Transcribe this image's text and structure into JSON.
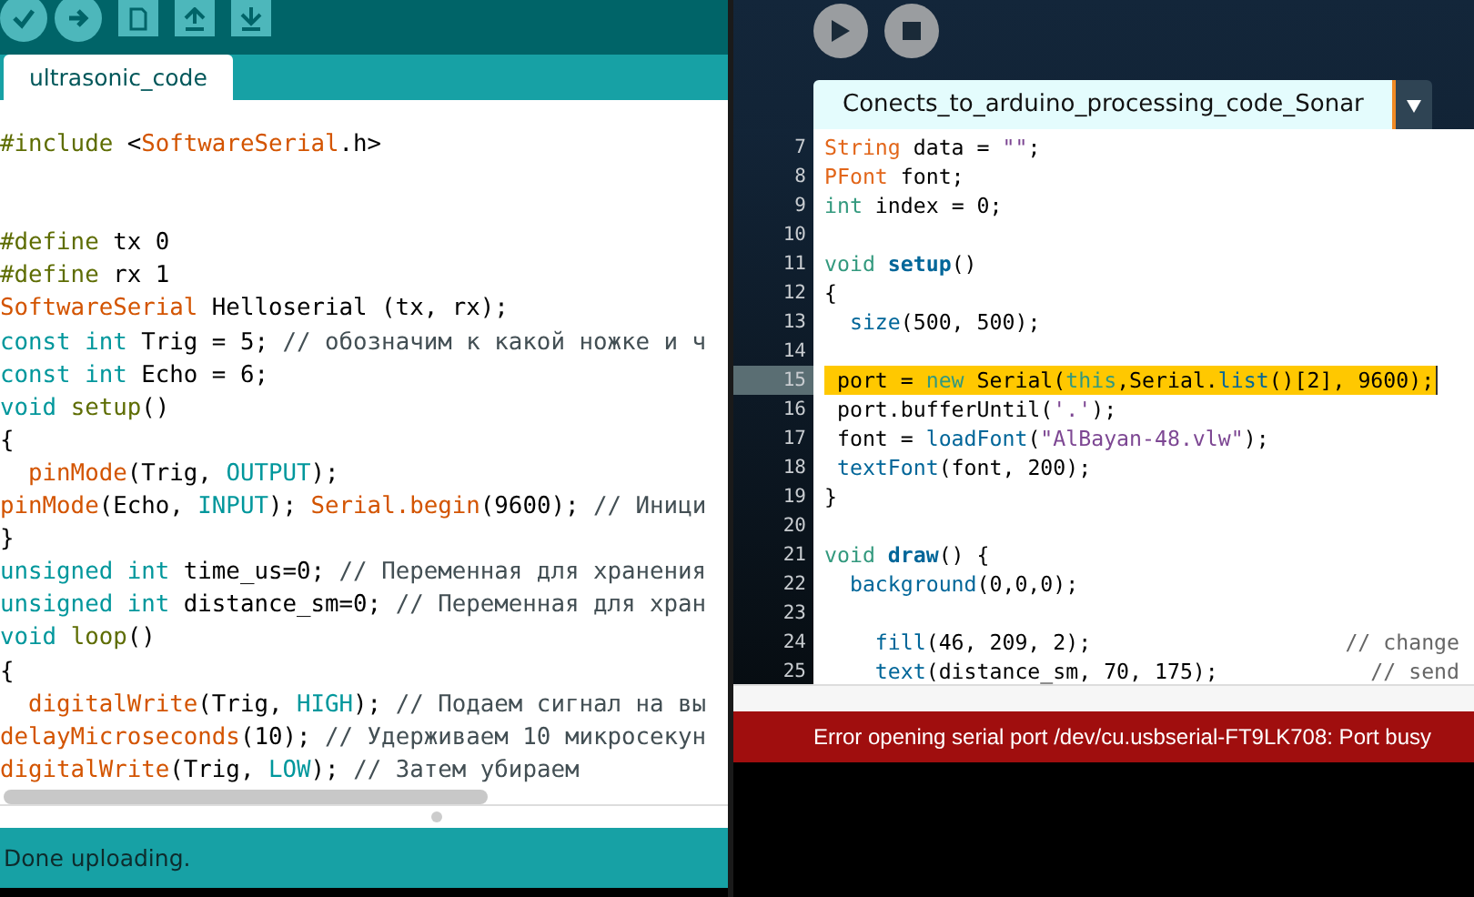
{
  "arduino": {
    "tab": {
      "label": "ultrasonic_code",
      "selected": true
    },
    "lines": [
      {
        "kind": "code",
        "tokens": [
          {
            "kind": "preproc",
            "text": "#include"
          },
          {
            "kind": "plain",
            "text": " <"
          },
          {
            "kind": "fn",
            "text": "SoftwareSerial"
          },
          {
            "kind": "plain",
            "text": ".h>"
          }
        ]
      },
      {
        "kind": "blank"
      },
      {
        "kind": "blank"
      },
      {
        "kind": "code",
        "tokens": [
          {
            "kind": "preproc",
            "text": "#define"
          },
          {
            "kind": "plain",
            "text": " tx 0"
          }
        ]
      },
      {
        "kind": "code",
        "tokens": [
          {
            "kind": "preproc",
            "text": "#define"
          },
          {
            "kind": "plain",
            "text": " rx 1"
          }
        ]
      },
      {
        "kind": "code",
        "tokens": [
          {
            "kind": "fn",
            "text": "SoftwareSerial"
          },
          {
            "kind": "plain",
            "text": " Helloserial (tx, rx);"
          }
        ]
      },
      {
        "kind": "code",
        "tokens": [
          {
            "kind": "type",
            "text": "const int"
          },
          {
            "kind": "plain",
            "text": " Trig = 5; "
          },
          {
            "kind": "comment",
            "text": "// обозначим к какой ножке и ч"
          }
        ]
      },
      {
        "kind": "code",
        "tokens": [
          {
            "kind": "type",
            "text": "const int"
          },
          {
            "kind": "plain",
            "text": " Echo = 6;"
          }
        ]
      },
      {
        "kind": "code",
        "tokens": [
          {
            "kind": "type",
            "text": "void "
          },
          {
            "kind": "preproc",
            "text": "setup"
          },
          {
            "kind": "plain",
            "text": "()"
          }
        ]
      },
      {
        "kind": "code",
        "tokens": [
          {
            "kind": "plain",
            "text": "{"
          }
        ]
      },
      {
        "kind": "code",
        "tokens": [
          {
            "kind": "fn",
            "text": "  pinMode"
          },
          {
            "kind": "plain",
            "text": "(Trig, "
          },
          {
            "kind": "type",
            "text": "OUTPUT"
          },
          {
            "kind": "plain",
            "text": ");"
          }
        ]
      },
      {
        "kind": "code",
        "tokens": [
          {
            "kind": "fn",
            "text": "pinMode"
          },
          {
            "kind": "plain",
            "text": "(Echo, "
          },
          {
            "kind": "type",
            "text": "INPUT"
          },
          {
            "kind": "plain",
            "text": "); "
          },
          {
            "kind": "fn",
            "text": "Serial.begin"
          },
          {
            "kind": "plain",
            "text": "(9600); "
          },
          {
            "kind": "comment",
            "text": "// Иници"
          }
        ]
      },
      {
        "kind": "code",
        "tokens": [
          {
            "kind": "plain",
            "text": "}"
          }
        ]
      },
      {
        "kind": "code",
        "tokens": [
          {
            "kind": "type",
            "text": "unsigned int"
          },
          {
            "kind": "plain",
            "text": " time_us=0; "
          },
          {
            "kind": "comment",
            "text": "// Переменная для хранения"
          }
        ]
      },
      {
        "kind": "code",
        "tokens": [
          {
            "kind": "type",
            "text": "unsigned int"
          },
          {
            "kind": "plain",
            "text": " distance_sm=0; "
          },
          {
            "kind": "comment",
            "text": "// Переменная для хран"
          }
        ]
      },
      {
        "kind": "code",
        "tokens": [
          {
            "kind": "type",
            "text": "void "
          },
          {
            "kind": "preproc",
            "text": "loop"
          },
          {
            "kind": "plain",
            "text": "()"
          }
        ]
      },
      {
        "kind": "code",
        "tokens": [
          {
            "kind": "plain",
            "text": "{"
          }
        ]
      },
      {
        "kind": "code",
        "tokens": [
          {
            "kind": "fn",
            "text": "  digitalWrite"
          },
          {
            "kind": "plain",
            "text": "(Trig, "
          },
          {
            "kind": "type",
            "text": "HIGH"
          },
          {
            "kind": "plain",
            "text": "); "
          },
          {
            "kind": "comment",
            "text": "// Подаем сигнал на вы"
          }
        ]
      },
      {
        "kind": "code",
        "tokens": [
          {
            "kind": "fn",
            "text": "delayMicroseconds"
          },
          {
            "kind": "plain",
            "text": "(10); "
          },
          {
            "kind": "comment",
            "text": "// Удерживаем 10 микросекун"
          }
        ]
      },
      {
        "kind": "code",
        "tokens": [
          {
            "kind": "fn",
            "text": "digitalWrite"
          },
          {
            "kind": "plain",
            "text": "(Trig, "
          },
          {
            "kind": "type",
            "text": "LOW"
          },
          {
            "kind": "plain",
            "text": "); "
          },
          {
            "kind": "comment",
            "text": "// Затем убираем"
          }
        ]
      }
    ],
    "status": "Done uploading."
  },
  "processing": {
    "tab": {
      "label": "Conects_to_arduino_processing_code_Sonar",
      "selected": true
    },
    "lines": [
      {
        "number": "7",
        "selected": false,
        "tokens": [
          {
            "kind": "ptype",
            "text": "String"
          },
          {
            "kind": "plain",
            "text": " data = "
          },
          {
            "kind": "string",
            "text": "\"\""
          },
          {
            "kind": "plain",
            "text": ";"
          }
        ]
      },
      {
        "number": "8",
        "selected": false,
        "tokens": [
          {
            "kind": "ptype",
            "text": "PFont"
          },
          {
            "kind": "plain",
            "text": " font;"
          }
        ]
      },
      {
        "number": "9",
        "selected": false,
        "tokens": [
          {
            "kind": "keyword",
            "text": "int"
          },
          {
            "kind": "plain",
            "text": " index = 0;"
          }
        ]
      },
      {
        "number": "10",
        "selected": false
      },
      {
        "number": "11",
        "selected": false,
        "tokens": [
          {
            "kind": "keyword",
            "text": "void "
          },
          {
            "kind": "fnbold",
            "text": "setup"
          },
          {
            "kind": "plain",
            "text": "()"
          }
        ]
      },
      {
        "number": "12",
        "selected": false,
        "tokens": [
          {
            "kind": "plain",
            "text": "{"
          }
        ]
      },
      {
        "number": "13",
        "selected": false,
        "tokens": [
          {
            "kind": "pfn",
            "text": "  size"
          },
          {
            "kind": "plain",
            "text": "(500, 500);"
          }
        ]
      },
      {
        "number": "14",
        "selected": false
      },
      {
        "number": "15",
        "selected": true,
        "tokens": [
          {
            "kind": "plain",
            "text": " port = "
          },
          {
            "kind": "keyword",
            "text": "new"
          },
          {
            "kind": "plain",
            "text": " Serial("
          },
          {
            "kind": "keyword",
            "text": "this"
          },
          {
            "kind": "plain",
            "text": ",Serial."
          },
          {
            "kind": "pfn",
            "text": "list"
          },
          {
            "kind": "plain",
            "text": "()[2], 9600);"
          }
        ]
      },
      {
        "number": "16",
        "selected": false,
        "tokens": [
          {
            "kind": "plain",
            "text": " port.bufferUntil("
          },
          {
            "kind": "string",
            "text": "'.'"
          },
          {
            "kind": "plain",
            "text": ");"
          }
        ]
      },
      {
        "number": "17",
        "selected": false,
        "tokens": [
          {
            "kind": "plain",
            "text": " font = "
          },
          {
            "kind": "pfn",
            "text": "loadFont"
          },
          {
            "kind": "plain",
            "text": "("
          },
          {
            "kind": "string",
            "text": "\"AlBayan-48.vlw\""
          },
          {
            "kind": "plain",
            "text": ");"
          }
        ]
      },
      {
        "number": "18",
        "selected": false,
        "tokens": [
          {
            "kind": "pfn",
            "text": " textFont"
          },
          {
            "kind": "plain",
            "text": "(font, 200);"
          }
        ]
      },
      {
        "number": "19",
        "selected": false,
        "tokens": [
          {
            "kind": "plain",
            "text": "}"
          }
        ]
      },
      {
        "number": "20",
        "selected": false
      },
      {
        "number": "21",
        "selected": false,
        "tokens": [
          {
            "kind": "keyword",
            "text": "void "
          },
          {
            "kind": "fnbold",
            "text": "draw"
          },
          {
            "kind": "plain",
            "text": "() {"
          }
        ]
      },
      {
        "number": "22",
        "selected": false,
        "tokens": [
          {
            "kind": "pfn",
            "text": "  background"
          },
          {
            "kind": "plain",
            "text": "(0,0,0);"
          }
        ]
      },
      {
        "number": "23",
        "selected": false
      },
      {
        "number": "24",
        "selected": false,
        "tokens": [
          {
            "kind": "pfn",
            "text": "    fill"
          },
          {
            "kind": "plain",
            "text": "(46, 209, 2);                    "
          },
          {
            "kind": "pcomment",
            "text": "// change"
          }
        ]
      },
      {
        "number": "25",
        "selected": false,
        "tokens": [
          {
            "kind": "pfn",
            "text": "    text"
          },
          {
            "kind": "plain",
            "text": "(distance_sm, 70, 175);            "
          },
          {
            "kind": "pcomment",
            "text": "// send"
          }
        ]
      }
    ],
    "error": "Error opening serial port /dev/cu.usbserial-FT9LK708: Port busy"
  }
}
